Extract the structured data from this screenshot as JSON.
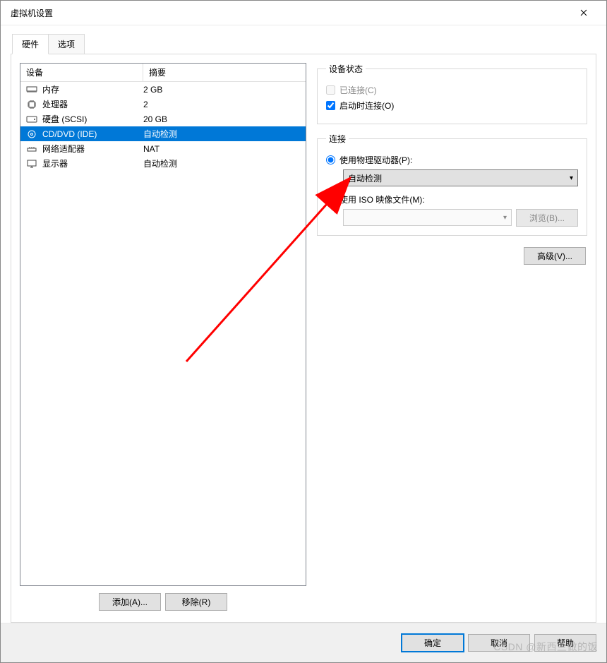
{
  "window": {
    "title": "虚拟机设置"
  },
  "tabs": {
    "hardware": "硬件",
    "options": "选项"
  },
  "list": {
    "header_device": "设备",
    "header_summary": "摘要",
    "rows": [
      {
        "name": "内存",
        "summary": "2 GB"
      },
      {
        "name": "处理器",
        "summary": "2"
      },
      {
        "name": "硬盘 (SCSI)",
        "summary": "20 GB"
      },
      {
        "name": "CD/DVD (IDE)",
        "summary": "自动检测"
      },
      {
        "name": "网络适配器",
        "summary": "NAT"
      },
      {
        "name": "显示器",
        "summary": "自动检测"
      }
    ]
  },
  "left_buttons": {
    "add": "添加(A)...",
    "remove": "移除(R)"
  },
  "status": {
    "legend": "设备状态",
    "connected": "已连接(C)",
    "connect_at_power_on": "启动时连接(O)"
  },
  "connection": {
    "legend": "连接",
    "use_physical": "使用物理驱动器(P):",
    "physical_option": "自动检测",
    "use_iso": "使用 ISO 映像文件(M):",
    "iso_path": "",
    "browse": "浏览(B)..."
  },
  "advanced": "高级(V)...",
  "bottom": {
    "ok": "确定",
    "cancel": "取消",
    "help": "帮助"
  },
  "watermark": "CSDN @新西兰做的饭"
}
